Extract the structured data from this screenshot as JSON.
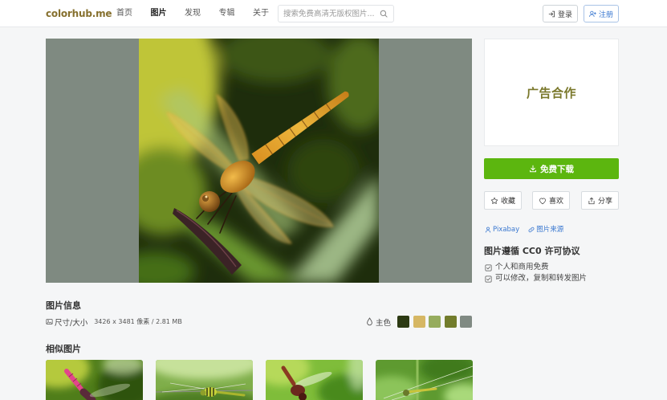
{
  "header": {
    "logo": "colorhub.me",
    "nav": [
      {
        "label": "首页"
      },
      {
        "label": "图片",
        "active": true
      },
      {
        "label": "发现"
      },
      {
        "label": "专辑"
      },
      {
        "label": "关于"
      }
    ],
    "search_placeholder": "搜索免费高清无版权图片...",
    "search_icon": "search-icon",
    "login_label": "登录",
    "login_icon": "login-icon",
    "register_label": "注册",
    "register_icon": "user-plus-icon"
  },
  "sidebar": {
    "ad_text": "广告合作",
    "download_label": "免费下载",
    "download_icon": "download-icon",
    "actions": [
      {
        "label": "收藏",
        "icon": "star-icon"
      },
      {
        "label": "喜欢",
        "icon": "heart-icon"
      },
      {
        "label": "分享",
        "icon": "share-icon"
      }
    ],
    "author": "Pixabay",
    "source_label": "图片来源",
    "license_title": "图片遵循 CC0 许可协议",
    "license_items": [
      "个人和商用免费",
      "可以修改，复制和转发图片"
    ]
  },
  "info": {
    "title": "图片信息",
    "size_label": "尺寸/大小",
    "size_value": "3426 x 3481 像素 / 2.81 MB",
    "main_color_label": "主色",
    "main_colors": [
      "#2c3a13",
      "#d6b764",
      "#96ac5e",
      "#727c2c",
      "#808a83"
    ]
  },
  "similar": {
    "title": "相似图片"
  },
  "theme": {
    "brand": "#86702e",
    "accent_green": "#5cb60f",
    "link_blue": "#3a78d0",
    "ad_text": "#7a782b"
  }
}
